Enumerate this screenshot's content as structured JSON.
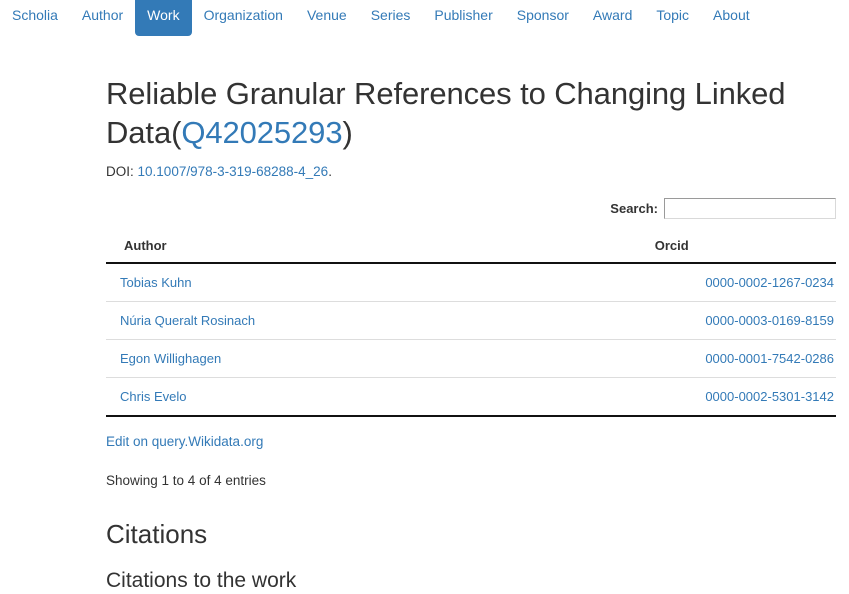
{
  "nav": {
    "items": [
      {
        "label": "Scholia",
        "active": false
      },
      {
        "label": "Author",
        "active": false
      },
      {
        "label": "Work",
        "active": true
      },
      {
        "label": "Organization",
        "active": false
      },
      {
        "label": "Venue",
        "active": false
      },
      {
        "label": "Series",
        "active": false
      },
      {
        "label": "Publisher",
        "active": false
      },
      {
        "label": "Sponsor",
        "active": false
      },
      {
        "label": "Award",
        "active": false
      },
      {
        "label": "Topic",
        "active": false
      },
      {
        "label": "About",
        "active": false
      }
    ],
    "accent_color": "#337ab7"
  },
  "work": {
    "title_text": "Reliable Granular References to Changing Linked Data (",
    "title_main": "Reliable Granular References to Changing Linked Data",
    "qid": "Q42025293",
    "title_open_paren": "(",
    "title_close_paren": ")",
    "doi_label": "DOI:",
    "doi_value": "10.1007/978-3-319-68288-4_26",
    "doi_period": "."
  },
  "search": {
    "label": "Search:",
    "value": "",
    "placeholder": ""
  },
  "authors_table": {
    "columns": [
      {
        "key": "author",
        "label": "Author"
      },
      {
        "key": "orcid",
        "label": "Orcid"
      }
    ],
    "rows": [
      {
        "author": "Tobias Kuhn",
        "orcid": "0000-0002-1267-0234"
      },
      {
        "author": "Núria Queralt Rosinach",
        "orcid": "0000-0003-0169-8159"
      },
      {
        "author": "Egon Willighagen",
        "orcid": "0000-0001-7542-0286"
      },
      {
        "author": "Chris Evelo",
        "orcid": "0000-0002-5301-3142"
      }
    ],
    "edit_link_label": "Edit on query.Wikidata.org",
    "entries_info": "Showing 1 to 4 of 4 entries"
  },
  "citations": {
    "heading": "Citations",
    "sub_heading": "Citations to the work"
  }
}
